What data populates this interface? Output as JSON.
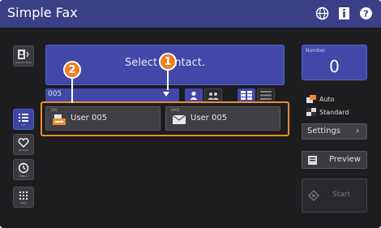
{
  "titlebar": {
    "title": "Simple Fax",
    "icons": [
      "globe-icon",
      "info-icon",
      "help-icon"
    ]
  },
  "sidebar": {
    "items": [
      {
        "name": "address-book",
        "label": "Address Book",
        "icon": "address-book-icon"
      },
      {
        "name": "list",
        "label": "List",
        "icon": "list-icon",
        "active": true
      },
      {
        "name": "favorite",
        "label": "Favorite",
        "icon": "heart-icon"
      },
      {
        "name": "history",
        "label": "History",
        "icon": "clock-icon"
      },
      {
        "name": "keypad",
        "label": "Keys",
        "icon": "keypad-icon"
      }
    ]
  },
  "main": {
    "select_prompt": "Select Contact.",
    "filter_value": "005",
    "view_toggles": [
      "single-user-icon",
      "group-icon",
      "grid-view-icon",
      "list-view-icon"
    ],
    "contacts": [
      {
        "id": "005",
        "name": "User 005",
        "icon": "fax-icon"
      },
      {
        "id": "0005",
        "name": "User 005",
        "icon": "email-icon"
      }
    ]
  },
  "callouts": [
    "1",
    "2"
  ],
  "right_panel": {
    "number_label": "Number",
    "number_value": "0",
    "options": [
      {
        "label": "Auto",
        "icon": "auto-icon"
      },
      {
        "label": "Standard",
        "icon": "standard-icon"
      }
    ],
    "settings_label": "Settings",
    "preview_label": "Preview",
    "start_label": "Start"
  },
  "colors": {
    "titlebar": "#3b3f86",
    "accent": "#4148a8",
    "highlight": "#f28a2e",
    "background": "#1d1d1f"
  }
}
